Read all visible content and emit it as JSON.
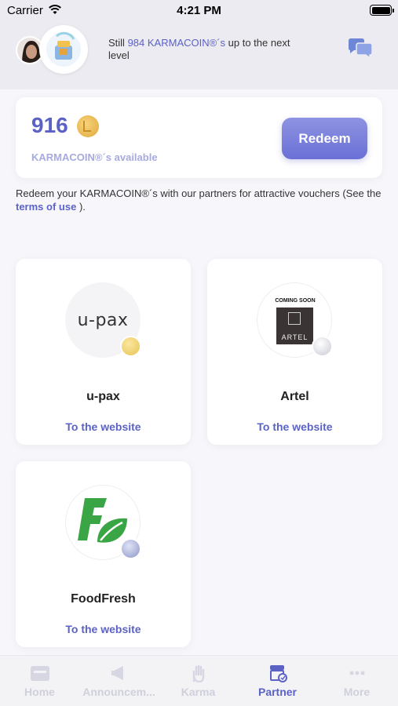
{
  "status_bar": {
    "carrier": "Carrier",
    "time": "4:21 PM"
  },
  "header": {
    "level_prefix": "Still",
    "level_highlight": "984 KARMACOIN®´s",
    "level_suffix": "up to the next level"
  },
  "balance": {
    "amount": "916",
    "label": "KARMACOIN®´s available",
    "redeem_label": "Redeem"
  },
  "info": {
    "text_before_link": "Redeem your KARMACOIN®´s with our partners for attractive vouchers (See the",
    "link": "terms of use",
    "text_after_link": ")."
  },
  "partners": [
    {
      "name": "u-pax",
      "logo_text": "u-pax",
      "link": "To the website",
      "badge": "gold"
    },
    {
      "name": "Artel",
      "logo_banner": "COMING SOON",
      "logo_text": "ARTEL",
      "link": "To the website",
      "badge": "diamond"
    },
    {
      "name": "FoodFresh",
      "logo_text": "F",
      "link": "To the website",
      "badge": "silver"
    }
  ],
  "tabs": [
    {
      "label": "Home",
      "icon": "home-icon"
    },
    {
      "label": "Announcem...",
      "icon": "megaphone-icon"
    },
    {
      "label": "Karma",
      "icon": "hand-icon"
    },
    {
      "label": "Partner",
      "icon": "partner-icon",
      "active": true
    },
    {
      "label": "More",
      "icon": "more-icon"
    }
  ],
  "colors": {
    "accent": "#5b62c6",
    "redeem_button": "#7b80dc",
    "inactive_tab": "#cfd0dc"
  }
}
